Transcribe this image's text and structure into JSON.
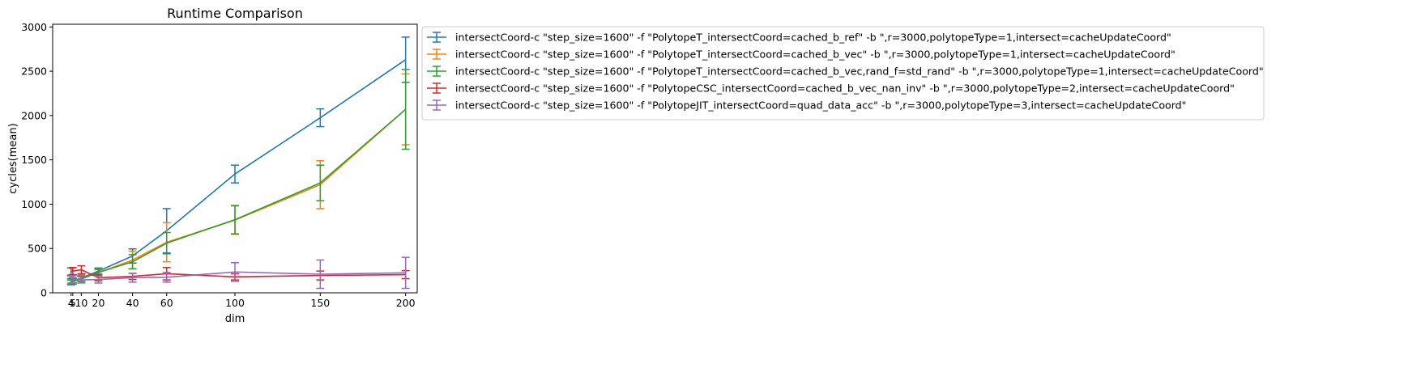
{
  "chart_data": {
    "type": "line",
    "title": "Runtime Comparison",
    "xlabel": "dim",
    "ylabel": "cycles(mean)",
    "x": [
      4,
      5,
      10,
      20,
      40,
      60,
      100,
      150,
      200
    ],
    "xticks": [
      4,
      5,
      10,
      20,
      40,
      60,
      100,
      150,
      200
    ],
    "xticklabels": [
      "4",
      "5",
      "10",
      "20",
      "40",
      "60",
      "100",
      "150",
      "200"
    ],
    "yticks": [
      0,
      500,
      1000,
      1500,
      2000,
      2500,
      3000
    ],
    "yticklabels": [
      "0",
      "500",
      "1000",
      "1500",
      "2000",
      "2500",
      "3000"
    ],
    "xlim": [
      -6.8,
      206.8
    ],
    "ylim": [
      0,
      3030
    ],
    "grid": false,
    "legend_position": "outside-upper-right",
    "series": [
      {
        "name": "intersectCoord-c \"step_size=1600\" -f \"PolytopeT_intersectCoord=cached_b_ref\" -b \",r=3000,polytopeType=1,intersect=cacheUpdateCoord\"",
        "color": "#1f77b4",
        "values": [
          125,
          135,
          165,
          245,
          415,
          700,
          1340,
          1975,
          2630
        ],
        "err": [
          35,
          35,
          35,
          35,
          80,
          250,
          100,
          100,
          255
        ]
      },
      {
        "name": "intersectCoord-c \"step_size=1600\" -f \"PolytopeT_intersectCoord=cached_b_vec\" -b \",r=3000,polytopeType=1,intersect=cacheUpdateCoord\"",
        "color": "#ff7f0e",
        "values": [
          120,
          130,
          160,
          225,
          370,
          570,
          820,
          1220,
          2070
        ],
        "err": [
          25,
          30,
          30,
          35,
          100,
          220,
          160,
          270,
          400
        ]
      },
      {
        "name": "intersectCoord-c \"step_size=1600\" -f \"PolytopeT_intersectCoord=cached_b_vec,rand_f=std_rand\" -b \",r=3000,polytopeType=1,intersect=cacheUpdateCoord\"",
        "color": "#2ca02c",
        "values": [
          118,
          128,
          155,
          230,
          350,
          560,
          825,
          1240,
          2070
        ],
        "err": [
          25,
          30,
          30,
          35,
          80,
          120,
          160,
          200,
          450
        ]
      },
      {
        "name": "intersectCoord-c \"step_size=1600\" -f \"PolytopeCSC_intersectCoord=cached_b_vec_nan_inv\" -b \",r=3000,polytopeType=2,intersect=cacheUpdateCoord\"",
        "color": "#d62728",
        "values": [
          240,
          245,
          260,
          170,
          185,
          215,
          180,
          195,
          205
        ],
        "err": [
          40,
          40,
          45,
          35,
          35,
          70,
          35,
          50,
          45
        ]
      },
      {
        "name": "intersectCoord-c \"step_size=1600\" -f \"PolytopeJIT_intersectCoord=quad_data_acc\" -b \",r=3000,polytopeType=3,intersect=cacheUpdateCoord\"",
        "color": "#9467bd",
        "values": [
          150,
          155,
          145,
          150,
          170,
          175,
          235,
          210,
          225
        ],
        "err": [
          40,
          40,
          35,
          40,
          50,
          55,
          105,
          160,
          175
        ]
      }
    ]
  }
}
